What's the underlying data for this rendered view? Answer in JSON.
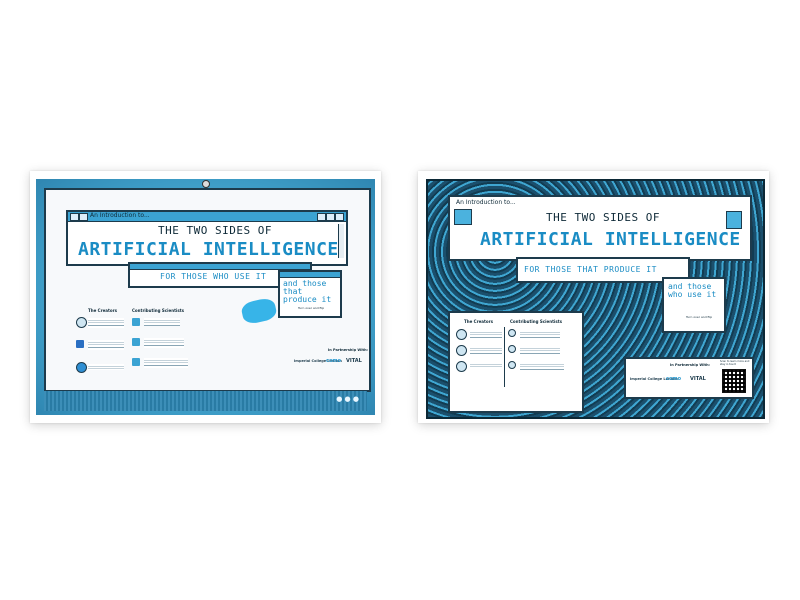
{
  "posters": [
    {
      "intro": "An Introduction to...",
      "title_line1": "THE TWO SIDES OF",
      "title_line2": "ARTIFICIAL INTELLIGENCE",
      "subtitle": "FOR THOSE WHO USE IT",
      "side_note": "and those that produce it",
      "turn_over": "Turn over and flip",
      "creators_header": "The Creators",
      "contributors_header": "Contributing Scientists",
      "partnership": "In Partnership With:",
      "partner_logos": [
        "Imperial College London",
        "como",
        "VITAL"
      ]
    },
    {
      "intro": "An Introduction to...",
      "title_line1": "THE TWO SIDES OF",
      "title_line2": "ARTIFICIAL INTELLIGENCE",
      "subtitle": "FOR THOSE THAT PRODUCE IT",
      "side_note": "and those who use it",
      "turn_over": "Turn over and flip",
      "creators_header": "The Creators",
      "contributors_header": "Contributing Scientists",
      "partnership": "In Partnership With:",
      "partner_logos": [
        "Imperial College London",
        "como",
        "VITAL"
      ],
      "qr_caption": "Scan to learn more and stay in touch"
    }
  ],
  "colors": {
    "accent": "#1a8cc4",
    "frame": "#1d3b4c",
    "screen_blue": "#4fb0d6"
  }
}
